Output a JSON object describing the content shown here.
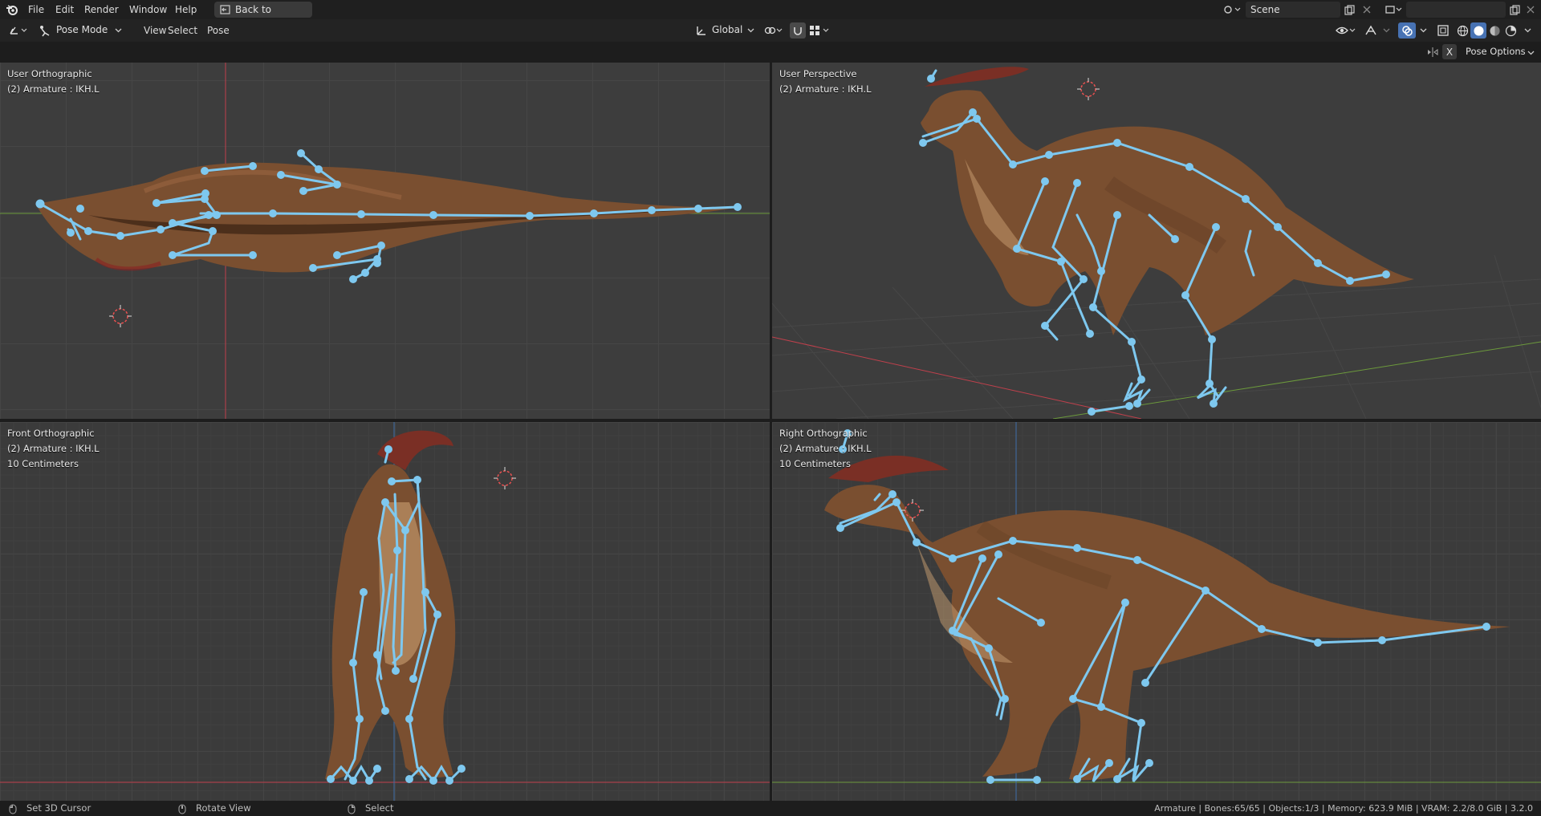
{
  "topbar": {
    "menu": [
      "File",
      "Edit",
      "Render",
      "Window",
      "Help"
    ],
    "back_button": "Back to Previous",
    "scene_name": "Scene",
    "view_layer": ""
  },
  "toolbar": {
    "mode": "Pose Mode",
    "menus": [
      "View",
      "Select",
      "Pose"
    ],
    "transform_orientation": "Global"
  },
  "header": {
    "x_label": "X",
    "pose_options": "Pose Options"
  },
  "viewports": [
    {
      "name": "User Orthographic",
      "object": "(2) Armature : IKH.L",
      "scale": ""
    },
    {
      "name": "User Perspective",
      "object": "(2) Armature : IKH.L",
      "scale": ""
    },
    {
      "name": "Front Orthographic",
      "object": "(2) Armature : IKH.L",
      "scale": "10 Centimeters"
    },
    {
      "name": "Right Orthographic",
      "object": "(2) Armature : IKH.L",
      "scale": "10 Centimeters"
    }
  ],
  "statusbar": {
    "hint_left": "Set 3D Cursor",
    "hint_middle": "Rotate View",
    "hint_right": "Select",
    "stats": "Armature | Bones:65/65 | Objects:1/3 | Memory: 623.9 MiB | VRAM: 2.2/8.0 GiB | 3.2.0"
  },
  "colors": {
    "bone": "#7ec8ef",
    "dino_body": "#7a4f30",
    "axis_red": "#c0404c",
    "axis_green": "#6c9a3c",
    "axis_blue": "#3f6ea8"
  },
  "icons": {
    "blender_logo": "blender-logo-icon",
    "editor_type": "3d-viewport-icon",
    "mode": "pose-mode-icon",
    "back": "back-to-previous-icon",
    "scene": "scene-icon",
    "view_layer": "view-layer-icon"
  }
}
